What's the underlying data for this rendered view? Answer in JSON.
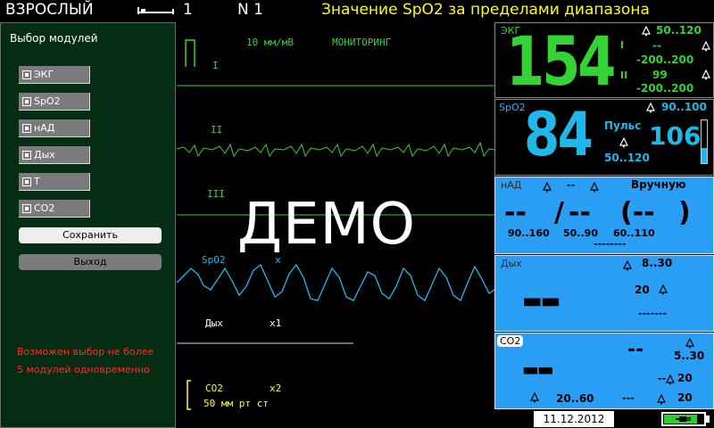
{
  "topbar": {
    "mode": "ВЗРОСЛЫЙ",
    "bed_number": "1",
    "net": "N 1",
    "alarm_message": "Значение SpO2 за пределами диапазона"
  },
  "menu": {
    "title": "Выбор модулей",
    "modules": [
      "ЭКГ",
      "SpO2",
      "нАД",
      "Дых",
      "T",
      "CO2"
    ],
    "save_label": "Сохранить",
    "exit_label": "Выход",
    "note_line1": "Возможен выбор не более",
    "note_line2": "5 модулей одновременно"
  },
  "waves": {
    "ecg_scale": "10 мм/мВ",
    "ecg_mode": "МОНИТОРИНГ",
    "lead1": "I",
    "lead2": "II",
    "lead3": "III",
    "spo2_label": "SpO2",
    "spo2_extra": "x",
    "resp_label": "Дых",
    "resp_gain": "x1",
    "co2_label": "CO2",
    "co2_gain": "x2",
    "co2_scale": "50 мм рт ст",
    "demo": "ДЕМО"
  },
  "ecg": {
    "label": "ЭКГ",
    "hr": "154",
    "hr_limits": "50..120",
    "st1_label": "I",
    "st1_value": "--",
    "st1_limits": "-200..200",
    "st2_label": "II",
    "st2_value": "99",
    "st2_limits": "-200..200"
  },
  "spo2": {
    "label": "SpO2",
    "value": "84",
    "limits": "90..100",
    "pulse_label": "Пульс",
    "pulse_value": "106",
    "pulse_limits": "50..120",
    "perfusion_level": 0.35
  },
  "nibp": {
    "label": "нАД",
    "mode_value": "--",
    "mode": "Вручную",
    "sys": "--",
    "slash": "/",
    "dia": "--",
    "map": "(--",
    "map_close": ")",
    "sys_limits": "90..160",
    "dia_limits": "50..90",
    "map_limits": "60..110",
    "time": "--------"
  },
  "resp": {
    "label": "Дых",
    "value": "▬▬",
    "limits": "8..30",
    "apnea": "20",
    "dashes": "-------"
  },
  "co2": {
    "label": "CO2",
    "value_dash": "--",
    "value": "▬▬",
    "et_limits": "5..30",
    "fi_dash": "--",
    "fi_value": "20",
    "resp_limits": "20..60",
    "resp_dash": "---",
    "resp_value": "20"
  },
  "status": {
    "date": "11.12.2012",
    "battery_level": 0.85
  },
  "colors": {
    "ecg": "#35d235",
    "spo2": "#1fb8e8",
    "alarm_text": "#ffff00",
    "note_text": "#ff2a2a",
    "param_panel_bg": "#2a9df4"
  }
}
